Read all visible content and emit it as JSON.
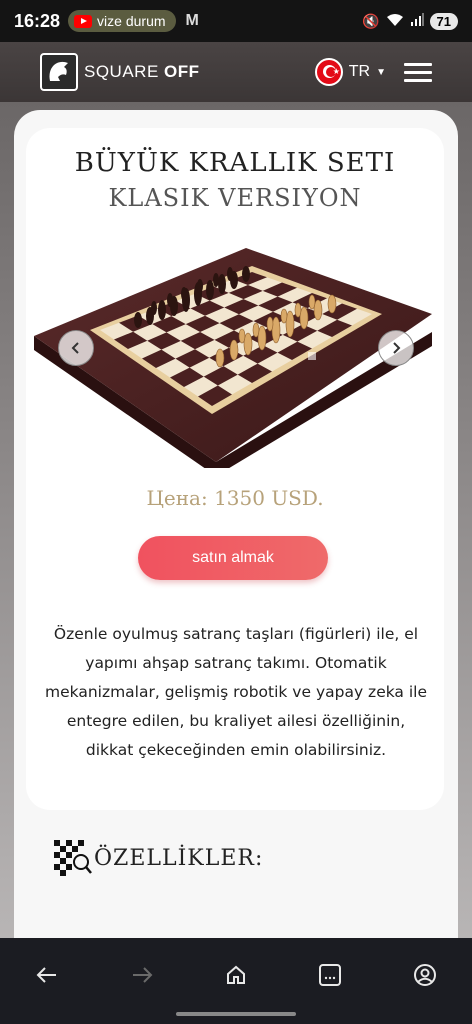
{
  "status_bar": {
    "time": "16:28",
    "notification": "vize durum",
    "battery": "71"
  },
  "header": {
    "logo_square": "SQUARE",
    "logo_off": "OFF",
    "language": "TR"
  },
  "product": {
    "title": "BÜYÜK KRALLIK SETI",
    "subtitle": "KLASIK VERSIYON",
    "price": "Цена: 1350 USD.",
    "buy_label": "satın almak",
    "description": "Özenle oyulmuş satranç taşları (figürleri) ile, el yapımı ahşap satranç takımı. Otomatik mekanizmalar, gelişmiş robotik ve yapay zeka ile entegre edilen, bu kraliyet ailesi özelliğinin, dikkat çekeceğinden emin olabilirsiniz."
  },
  "features": {
    "heading": "ÖZELLİKLER:"
  },
  "colors": {
    "accent": "#f0525f",
    "price": "#b7a27a",
    "header_bg": "#3b3636"
  },
  "icons": {
    "prev": "chevron-left-icon",
    "next": "chevron-right-icon",
    "nav_back": "arrow-left-icon",
    "nav_forward": "arrow-right-icon",
    "nav_home": "home-icon",
    "nav_tabs": "tabs-icon",
    "nav_account": "account-icon"
  }
}
